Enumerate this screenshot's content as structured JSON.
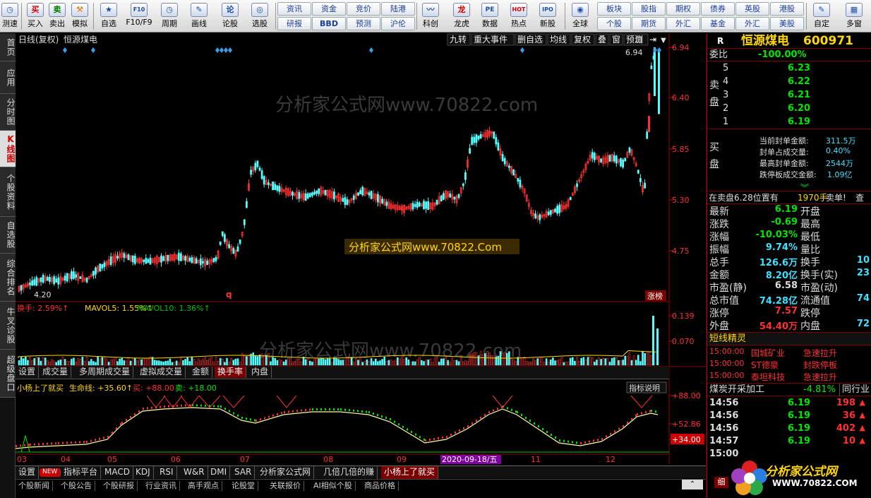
{
  "toolbar": {
    "buttons": [
      {
        "label": "测速",
        "icon": "clock-icon",
        "glyph": "◷"
      },
      {
        "label": "买入",
        "icon": "buy-icon",
        "glyph": "买"
      },
      {
        "label": "卖出",
        "icon": "sell-icon",
        "glyph": "卖"
      },
      {
        "label": "模拟",
        "icon": "hammer-icon",
        "glyph": "⚒"
      },
      {
        "label": "自选",
        "icon": "star-icon",
        "glyph": "★"
      },
      {
        "label": "F10/F9",
        "icon": "f10-icon",
        "glyph": "F10"
      },
      {
        "label": "周期",
        "icon": "period-icon",
        "glyph": "◷"
      },
      {
        "label": "画线",
        "icon": "pen-icon",
        "glyph": "✎"
      },
      {
        "label": "论股",
        "icon": "discuss-icon",
        "glyph": "论"
      },
      {
        "label": "选股",
        "icon": "select-stock-icon",
        "glyph": "◎"
      },
      {
        "label": "科创",
        "icon": "kechuang-icon",
        "glyph": "〰"
      },
      {
        "label": "龙虎",
        "icon": "dragon-icon",
        "glyph": "龙"
      },
      {
        "label": "数据",
        "icon": "pe-icon",
        "glyph": "PE"
      },
      {
        "label": "热点",
        "icon": "hot-icon",
        "glyph": "HOT"
      },
      {
        "label": "新股",
        "icon": "ipo-icon",
        "glyph": "IPO"
      },
      {
        "label": "全球",
        "icon": "globe-icon",
        "glyph": "◉"
      },
      {
        "label": "自定",
        "icon": "custom-icon",
        "glyph": "✎"
      },
      {
        "label": "多窗",
        "icon": "multiwindow-icon",
        "glyph": "▦"
      }
    ],
    "grid1": [
      "资讯",
      "资金",
      "竞价",
      "陆港",
      "研报",
      "BBD",
      "预测",
      "沪伦"
    ],
    "grid2": [
      "板块",
      "股指",
      "期权",
      "债券",
      "英股",
      "港股",
      "个股",
      "期货",
      "外汇",
      "基金",
      "外汇",
      "美股"
    ]
  },
  "sidetabs": [
    "首页",
    "应用",
    "分时图",
    "K线图",
    "个股资料",
    "自选股",
    "综合排名",
    "牛叉诊股",
    "超级盘口"
  ],
  "chart_header": {
    "period_label": "日线(复权)",
    "stock_name": "恒源煤电",
    "toolbar": [
      "九转",
      "重大事件",
      "删自选",
      "均线",
      "复权",
      "叠",
      "窗",
      "预测"
    ]
  },
  "price_axis": [
    "6.94",
    "6.40",
    "5.85",
    "5.30",
    "4.75"
  ],
  "labels": {
    "high_marker": "6.94",
    "low_marker": "4.20",
    "q_marker": "q",
    "zhang_bang": "涨榜",
    "watermark": "分析家公式网www.70822.com",
    "watermark_box": "分析家公式网www.70822.Com",
    "watermark_small": "分析家公式网www.70822.com"
  },
  "volume_panel": {
    "label": "换手: 2.59%↑",
    "mavol5": "MAVOL5: 1.55%↑",
    "mavol10": "MAVOL10: 1.36%↑",
    "axis": [
      "0.139",
      "0.070"
    ]
  },
  "volume_tabs": [
    "设置",
    "成交量",
    "多周期成交量",
    "虚拟成交量",
    "金额",
    "换手率",
    "内盘"
  ],
  "indicator_panel": {
    "name": "小杨上了就买",
    "line": "生命线: +35.60↑",
    "buy": "买: +88.00",
    "sell": "卖: +18.00",
    "help": "指标说明",
    "axis": [
      "+88.00",
      "+52.86",
      "+34.00"
    ]
  },
  "x_axis": [
    "03",
    "04",
    "05",
    "06",
    "07",
    "08",
    "09",
    "10",
    "11",
    "12"
  ],
  "cursor_date": "2020-09-18/五",
  "indicator_tabs": [
    "设置",
    "NEW",
    "指标平台",
    "MACD",
    "KDJ",
    "RSI",
    "W&R",
    "DMI",
    "SAR",
    "分析家公式网",
    "几倍几倍的赚",
    "小杨上了就买"
  ],
  "news_tabs": [
    "个股新闻",
    "个股公告",
    "个股研报",
    "行业资讯",
    "高手观点",
    "论股堂",
    "关联报价",
    "AI相似个股",
    "商品价格"
  ],
  "right": {
    "market": "R",
    "name": "恒源煤电",
    "code": "600971",
    "weibi_label": "委比",
    "weibi_value": "-100.00%",
    "sell_label": "卖盘",
    "asks": [
      {
        "n": "5",
        "p": "6.23"
      },
      {
        "n": "4",
        "p": "6.22"
      },
      {
        "n": "3",
        "p": "6.21"
      },
      {
        "n": "2",
        "p": "6.20"
      },
      {
        "n": "1",
        "p": "6.19"
      }
    ],
    "buy_label": "买盘",
    "seal_info": [
      {
        "k": "当前封单金额:",
        "v": "311.5万"
      },
      {
        "k": "封单占成交量:",
        "v": "0.40%"
      },
      {
        "k": "最高封单金额:",
        "v": "2544万"
      },
      {
        "k": "跌停板成交金额:",
        "v": "1.09亿"
      }
    ],
    "sell_pos": "在卖盘6.28位置有",
    "sell_pos_vol": "1970手",
    "sell_pos_tail": "卖单!",
    "sell_pos_btn": "查",
    "stats": [
      [
        "最新",
        "6.19",
        "开盘",
        ""
      ],
      [
        "涨跌",
        "-0.69",
        "最高",
        ""
      ],
      [
        "涨幅",
        "-10.03%",
        "最低",
        ""
      ],
      [
        "振幅",
        "9.74%",
        "量比",
        ""
      ],
      [
        "总手",
        "126.6万",
        "换手",
        "10"
      ],
      [
        "金额",
        "8.20亿",
        "换手(实)",
        "23"
      ],
      [
        "市盈(静)",
        "6.58",
        "市盈(动)",
        ""
      ],
      [
        "总市值",
        "74.28亿",
        "流通值",
        "74"
      ],
      [
        "涨停",
        "7.57",
        "跌停",
        ""
      ],
      [
        "外盘",
        "54.40万",
        "内盘",
        "72"
      ]
    ],
    "short_title": "短线精灵",
    "short_items": [
      {
        "t": "15:00:00",
        "n": "国城矿业",
        "s": "急速拉升"
      },
      {
        "t": "15:00:00",
        "n": "ST德豪",
        "s": "封跌停板"
      },
      {
        "t": "15:00:00",
        "n": "泰坦科技",
        "s": "急速拉升"
      }
    ],
    "industry": "煤炭开采加工",
    "industry_pct": "-4.81%",
    "industry_btn": "同行业",
    "ticks": [
      {
        "t": "14:56",
        "p": "6.19",
        "v": "198"
      },
      {
        "t": "14:56",
        "p": "6.19",
        "v": "36"
      },
      {
        "t": "14:56",
        "p": "6.19",
        "v": "402"
      },
      {
        "t": "14:57",
        "p": "6.19",
        "v": "10"
      },
      {
        "t": "15:00",
        "p": "",
        "v": ""
      }
    ],
    "detail_btn": "细",
    "logo_text": "分析家公式网",
    "logo_url": "WWW.70822.COM"
  }
}
